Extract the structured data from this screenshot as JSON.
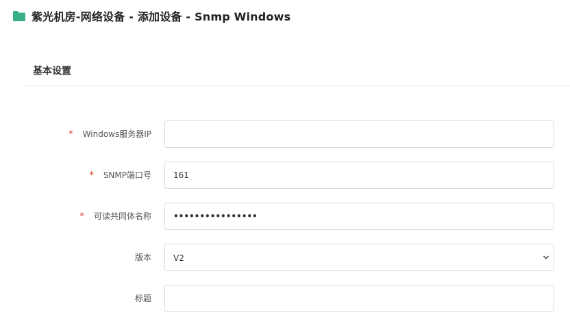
{
  "header": {
    "title": "紫光机房-网络设备 - 添加设备 - Snmp Windows",
    "icon": "folder-icon",
    "icon_color": "#3aaf85"
  },
  "section": {
    "title": "基本设置"
  },
  "form": {
    "required_mark": "*",
    "fields": [
      {
        "label": "Windows服务器IP",
        "required": true,
        "value": "",
        "type": "text"
      },
      {
        "label": "SNMP端口号",
        "required": true,
        "value": "161",
        "type": "text"
      },
      {
        "label": "可读共同体名称",
        "required": true,
        "value": "••••••••••••••••",
        "type": "password"
      },
      {
        "label": "版本",
        "required": false,
        "value": "V2",
        "type": "select"
      },
      {
        "label": "标题",
        "required": false,
        "value": "",
        "type": "text"
      }
    ]
  },
  "colors": {
    "required": "#e0391f",
    "border": "#d9d9d9",
    "divider": "#e6e6e6"
  }
}
